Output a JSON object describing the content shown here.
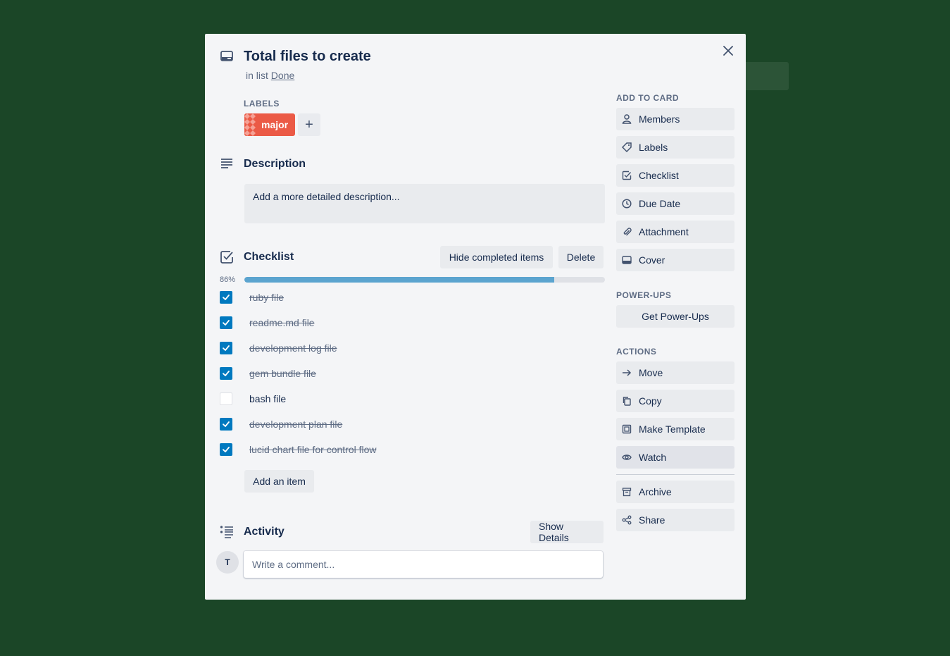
{
  "card": {
    "title": "Total files to create",
    "in_list_prefix": "in list",
    "list_name": "Done",
    "close_icon": "close-icon"
  },
  "labels": {
    "header": "LABELS",
    "items": [
      {
        "name": "major",
        "color": "#eb5a46"
      }
    ],
    "add_icon": "plus-icon",
    "add_glyph": "+"
  },
  "description": {
    "title": "Description",
    "placeholder": "Add a more detailed description..."
  },
  "checklist": {
    "title": "Checklist",
    "hide_label": "Hide completed items",
    "delete_label": "Delete",
    "percent_text": "86%",
    "progress": 0.86,
    "items": [
      {
        "text": "ruby file",
        "done": true
      },
      {
        "text": "readme.md file",
        "done": true
      },
      {
        "text": "development log file",
        "done": true
      },
      {
        "text": "gem bundle file",
        "done": true
      },
      {
        "text": "bash file",
        "done": false
      },
      {
        "text": "development plan file",
        "done": true
      },
      {
        "text": "lucid chart file for control flow",
        "done": true
      }
    ],
    "add_item_label": "Add an item"
  },
  "activity": {
    "title": "Activity",
    "show_details_label": "Show Details",
    "avatar_initial": "T",
    "comment_placeholder": "Write a comment..."
  },
  "sidebar": {
    "add_to_card_header": "ADD TO CARD",
    "add_to_card": [
      {
        "label": "Members",
        "icon": "person-icon"
      },
      {
        "label": "Labels",
        "icon": "tag-icon"
      },
      {
        "label": "Checklist",
        "icon": "checklist-icon"
      },
      {
        "label": "Due Date",
        "icon": "clock-icon"
      },
      {
        "label": "Attachment",
        "icon": "paperclip-icon"
      },
      {
        "label": "Cover",
        "icon": "cover-icon"
      }
    ],
    "power_ups_header": "POWER-UPS",
    "get_power_ups_label": "Get Power-Ups",
    "actions_header": "ACTIONS",
    "actions": [
      {
        "label": "Move",
        "icon": "arrow-right-icon"
      },
      {
        "label": "Copy",
        "icon": "copy-icon"
      },
      {
        "label": "Make Template",
        "icon": "template-icon"
      },
      {
        "label": "Watch",
        "icon": "eye-icon"
      },
      {
        "label": "Archive",
        "icon": "archive-icon"
      },
      {
        "label": "Share",
        "icon": "share-icon"
      }
    ]
  },
  "colors": {
    "board_background": "#1b4627",
    "checkbox_checked": "#0079bf",
    "progress_fill": "#5ba4cf"
  }
}
